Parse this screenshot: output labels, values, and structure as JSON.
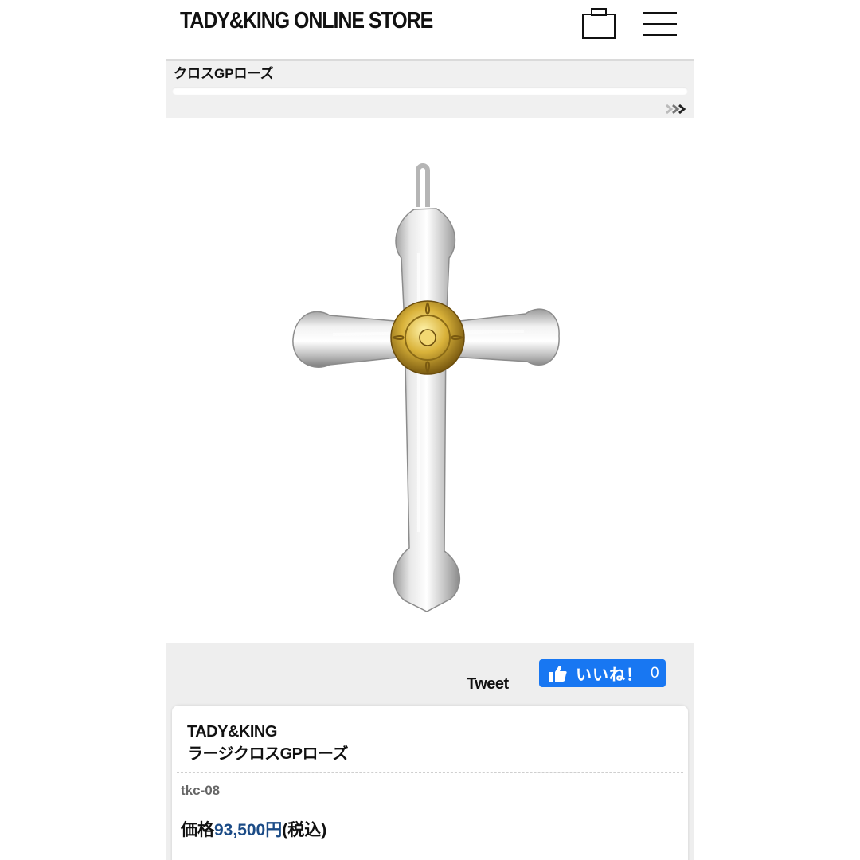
{
  "header": {
    "store_name": "TADY&KING ONLINE STORE",
    "cart_icon": "cart-icon",
    "menu_icon": "hamburger-menu-icon"
  },
  "category": {
    "title": "クロスGPローズ",
    "next_icon": "double-chevron-right-icon"
  },
  "product_image": {
    "alt": "cross-pendant-image"
  },
  "social": {
    "tweet_label": "Tweet",
    "like_label": "いいね！",
    "like_count": "0",
    "like_icon": "thumbs-up-icon",
    "like_color": "#1877f2"
  },
  "product": {
    "brand": "TADY&KING",
    "name": "ラージクロスGPローズ",
    "sku": "tkc-08",
    "price_prefix": "価格",
    "price_value": "93,500円",
    "price_suffix": "(税込)",
    "price_color": "#1b4b86"
  }
}
